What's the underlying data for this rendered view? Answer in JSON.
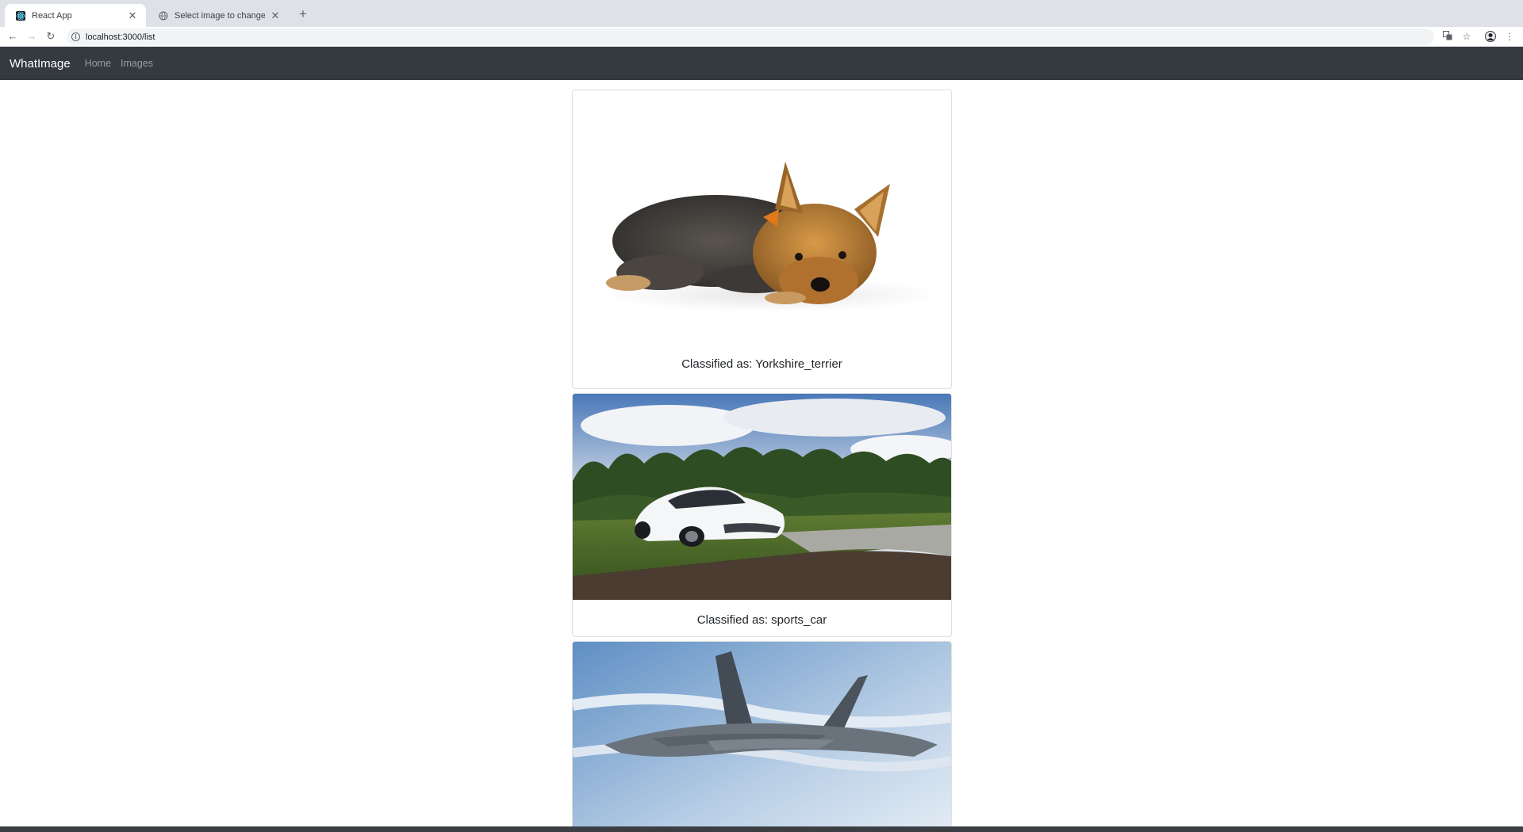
{
  "browser": {
    "tabs": [
      {
        "title": "React App",
        "active": true
      },
      {
        "title": "Select image to change | Djang",
        "active": false
      }
    ],
    "url": "localhost:3000/list"
  },
  "app": {
    "brand": "WhatImage",
    "nav": [
      {
        "label": "Home"
      },
      {
        "label": "Images"
      }
    ]
  },
  "cards": [
    {
      "caption": "Classified as: Yorkshire_terrier",
      "image": "yorkshire-terrier-photo"
    },
    {
      "caption": "Classified as: sports_car",
      "image": "white-sports-car-photo"
    },
    {
      "caption": "",
      "image": "fighter-jet-photo"
    }
  ],
  "colors": {
    "navbar": "#343a40",
    "tabstrip": "#dee1e6"
  }
}
